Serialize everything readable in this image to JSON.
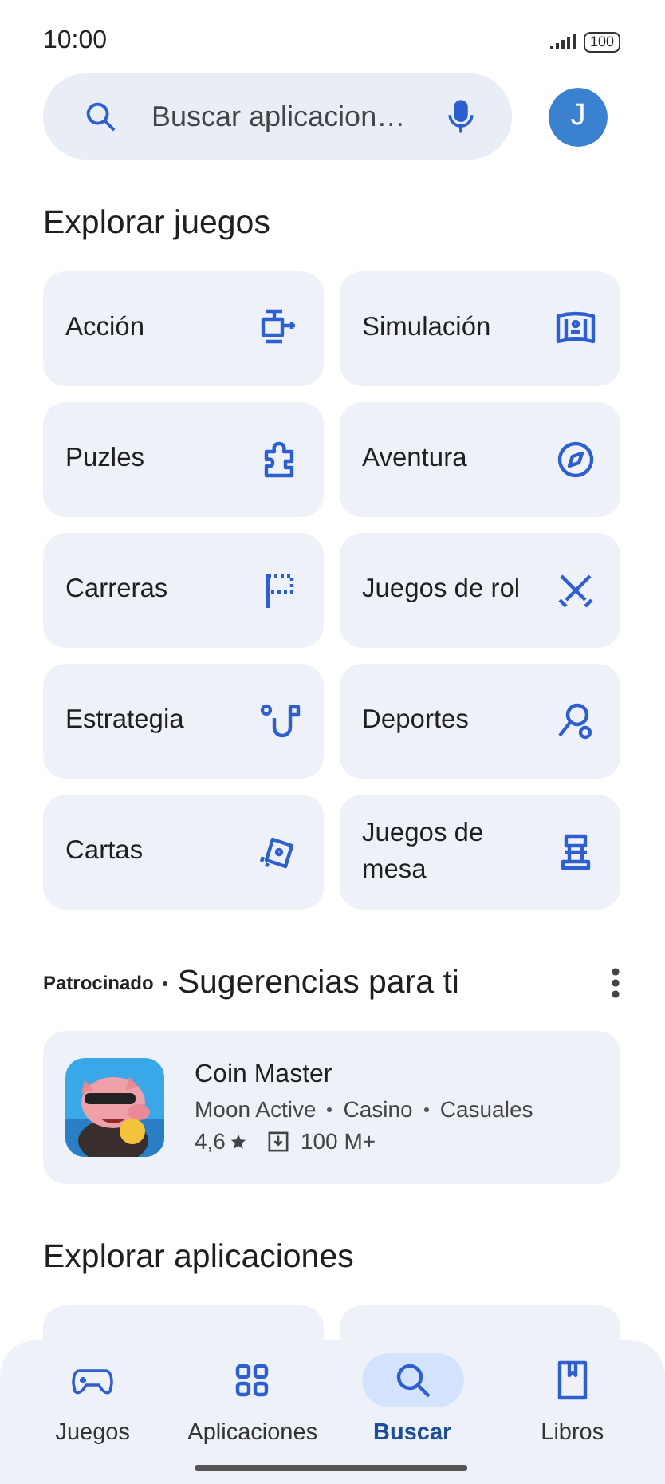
{
  "status_bar": {
    "time": "10:00",
    "battery": "100"
  },
  "search": {
    "placeholder": "Buscar aplicacion…",
    "avatar": "J"
  },
  "games_section": {
    "title": "Explorar juegos",
    "categories": [
      {
        "label": "Acción"
      },
      {
        "label": "Puzles"
      },
      {
        "label": "Carreras"
      },
      {
        "label": "Estrategia"
      },
      {
        "label": "Cartas"
      },
      {
        "label": "Simulación"
      },
      {
        "label": "Aventura"
      },
      {
        "label": "Juegos de rol"
      },
      {
        "label": "Deportes"
      },
      {
        "label": "Juegos de mesa"
      }
    ]
  },
  "sponsored": {
    "badge": "Patrocinado",
    "title": "Sugerencias para ti",
    "app": {
      "name": "Coin Master",
      "developer": "Moon Active",
      "tags": [
        "Casino",
        "Casuales"
      ],
      "rating": "4,6",
      "downloads": "100 M+"
    }
  },
  "apps_section": {
    "title": "Explorar aplicaciones"
  },
  "nav": [
    {
      "label": "Juegos",
      "selected": false
    },
    {
      "label": "Aplicaciones",
      "selected": false
    },
    {
      "label": "Buscar",
      "selected": true
    },
    {
      "label": "Libros",
      "selected": false
    }
  ]
}
